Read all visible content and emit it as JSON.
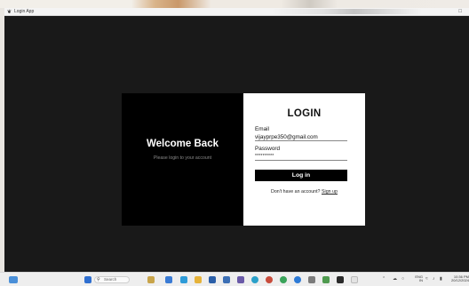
{
  "window": {
    "title": "Login App",
    "close_glyph": "□"
  },
  "welcome": {
    "heading": "Welcome Back",
    "subtitle": "Please login to your account"
  },
  "login": {
    "title": "LOGIN",
    "email_label": "Email",
    "email_value": "vijayprpe350@gmail.com",
    "password_label": "Password",
    "password_value": "**********",
    "button_label": "Log in",
    "signup_prompt": "Don't have an account?",
    "signup_link": "Sign up"
  },
  "taskbar": {
    "search_placeholder": "Search",
    "tray_lang": "ENG",
    "tray_region": "IN",
    "tray_time": "10:36 PM",
    "tray_date": "20/12/2024"
  },
  "colors": {
    "window_bg": "#191919",
    "left_panel": "#000000",
    "right_panel": "#ffffff",
    "button_bg": "#000000"
  }
}
